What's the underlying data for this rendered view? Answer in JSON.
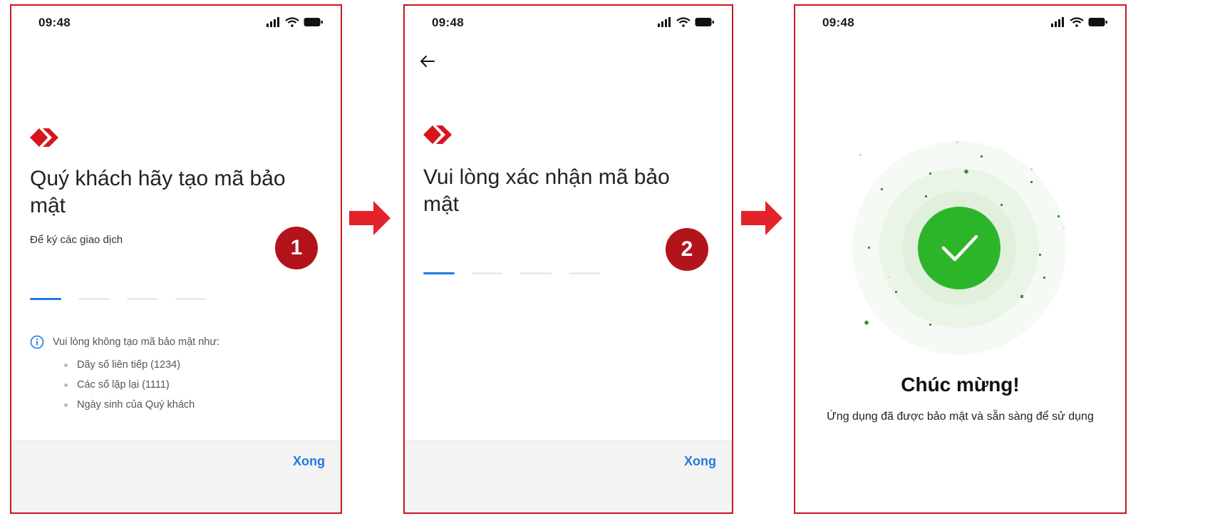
{
  "status_time": "09:48",
  "colors": {
    "brand_red": "#c8161d",
    "accent_blue": "#1e7be0",
    "success_green": "#2db52a"
  },
  "screen1": {
    "title": "Quý khách hãy tạo mã bảo mật",
    "subtitle": "Để ký các giao dịch",
    "step_number": "1",
    "pin_length": 4,
    "pin_entered": 0,
    "notice_heading": "Vui lòng không tạo mã bảo mật như:",
    "notice_items": [
      "Dãy số liên tiếp (1234)",
      "Các số lặp lại (1111)",
      "Ngày sinh của Quý khách"
    ],
    "done_label": "Xong"
  },
  "screen2": {
    "title": "Vui lòng xác nhận mã bảo mật",
    "step_number": "2",
    "pin_length": 4,
    "pin_entered": 0,
    "done_label": "Xong"
  },
  "screen3": {
    "title": "Chúc mừng!",
    "message": "Ứng dụng đã được bảo mật và sẵn sàng để sử dụng"
  },
  "icons": [
    "signal-icon",
    "wifi-icon",
    "battery-icon",
    "back-arrow-icon",
    "brand-logo-icon",
    "info-icon",
    "check-icon",
    "flow-arrow-icon"
  ]
}
